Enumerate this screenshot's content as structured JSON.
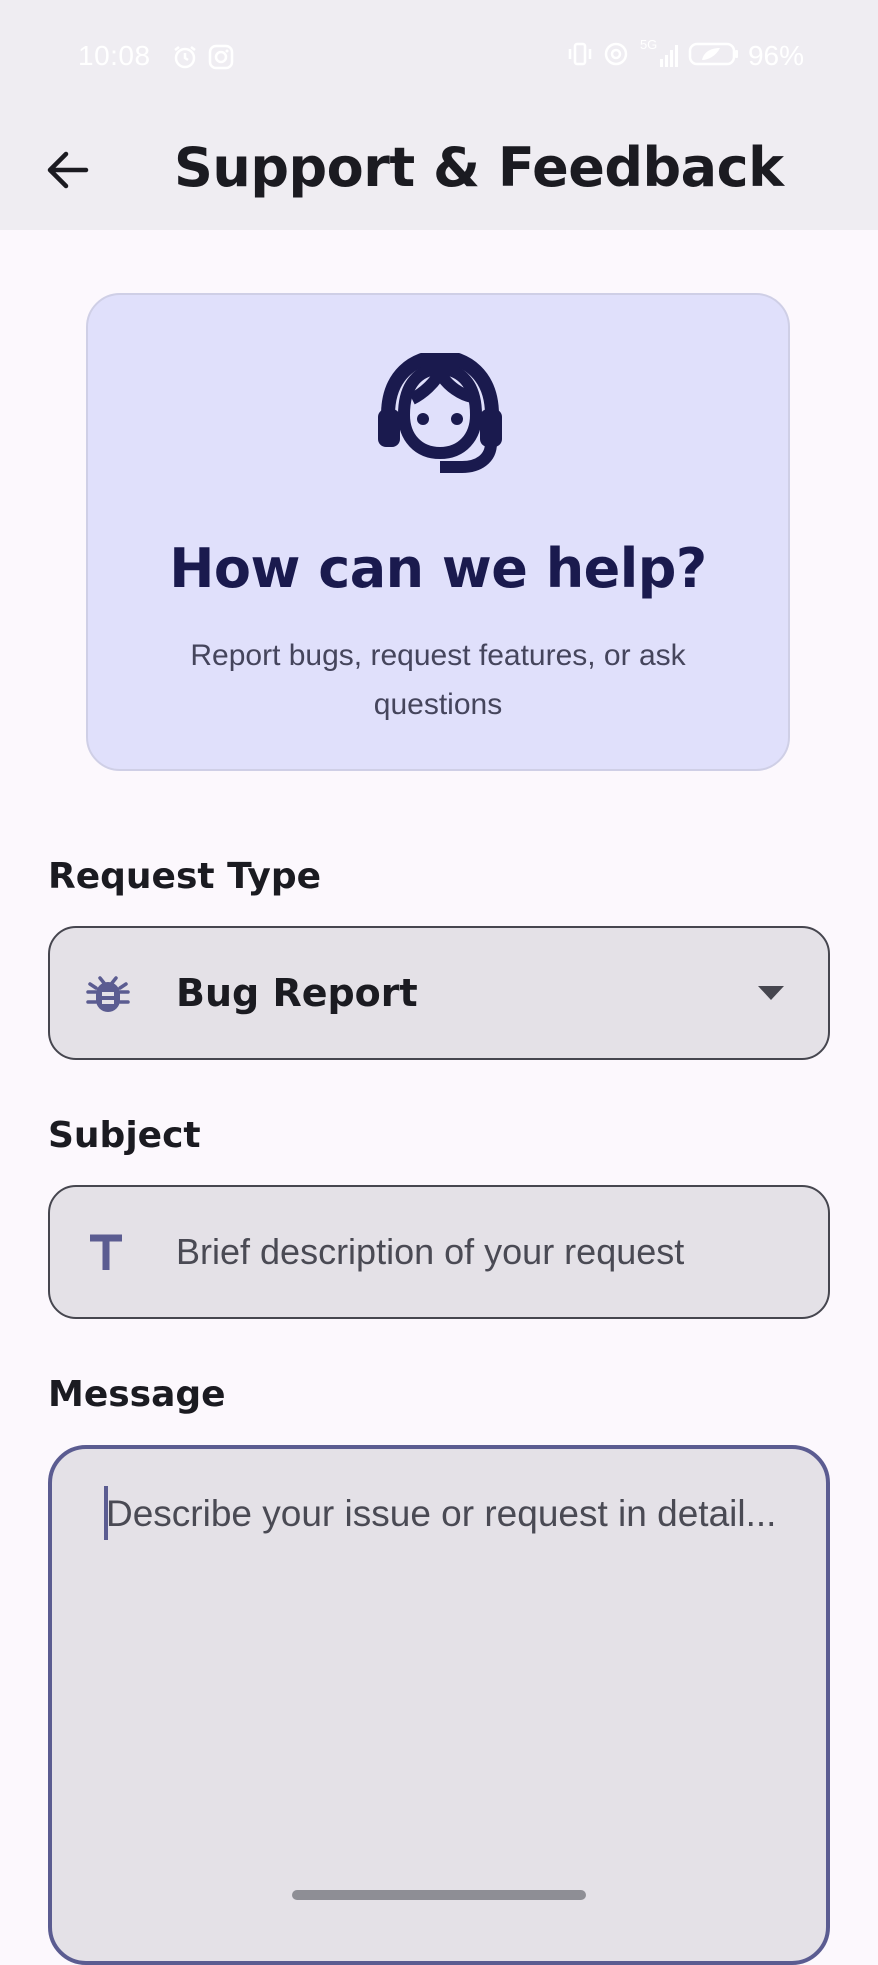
{
  "status_bar": {
    "time": "10:08",
    "left_icons": [
      "alarm-icon",
      "instagram-icon"
    ],
    "right_icons": [
      "vibrate-icon",
      "hotspot-icon",
      "signal-5g-icon",
      "battery-saver-icon"
    ],
    "network_label": "5G",
    "battery_percent": "96%"
  },
  "app_bar": {
    "back_icon": "arrow-back-icon",
    "title": "Support & Feedback"
  },
  "hero": {
    "icon": "support-agent-icon",
    "title": "How can we help?",
    "subtitle": "Report bugs, request features, or ask questions"
  },
  "form": {
    "request_type": {
      "label": "Request Type",
      "icon": "bug-icon",
      "selected": "Bug Report"
    },
    "subject": {
      "label": "Subject",
      "icon": "text-t-icon",
      "value": "",
      "placeholder": "Brief description of your request"
    },
    "message": {
      "label": "Message",
      "value": "",
      "placeholder": "Describe your issue or request in detail..."
    }
  },
  "colors": {
    "background": "#fcf8fd",
    "app_bar": "#efedf2",
    "hero_card": "#e0e0fb",
    "accent": "#5b5c91",
    "hero_title": "#1a1a4e",
    "field_fill": "#e4e1e7"
  }
}
